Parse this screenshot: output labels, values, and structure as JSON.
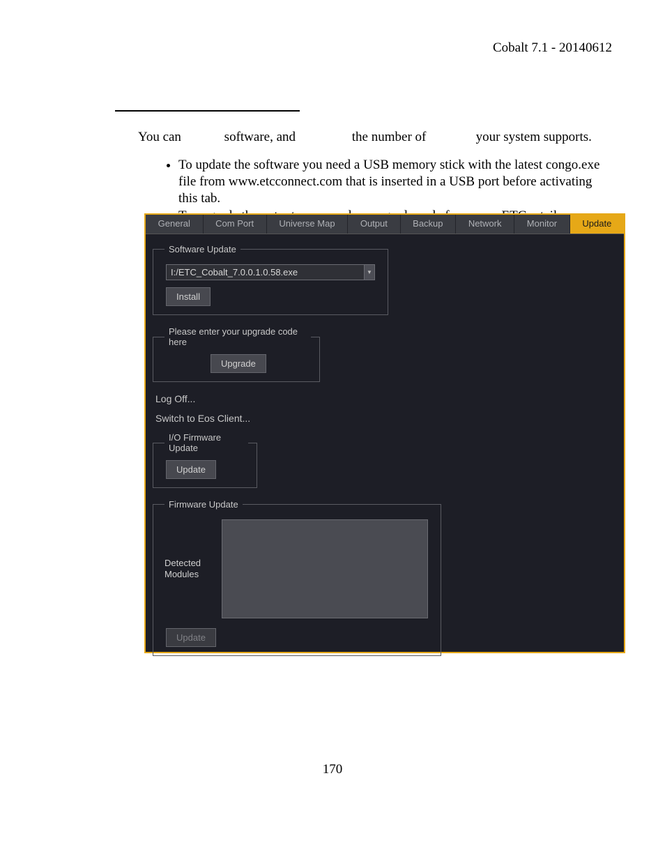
{
  "header": {
    "title": "Cobalt 7.1 - 20140612"
  },
  "intro": {
    "text": "You can             software, and                 the number of               your system supports."
  },
  "bullets": [
    "To update the software you need a USB memory stick with the latest congo.exe file from www.etcconnect.com that is inserted in a USB port before activating this tab.",
    "To upgrade the outputs you need an upgrade code from your ETC retailer."
  ],
  "page_number": "170",
  "app": {
    "tabs": [
      {
        "label": "General",
        "active": false
      },
      {
        "label": "Com Port",
        "active": false
      },
      {
        "label": "Universe Map",
        "active": false
      },
      {
        "label": "Output",
        "active": false
      },
      {
        "label": "Backup",
        "active": false
      },
      {
        "label": "Network",
        "active": false
      },
      {
        "label": "Monitor",
        "active": false
      },
      {
        "label": "Update",
        "active": true
      }
    ],
    "software_update": {
      "legend": "Software Update",
      "path": "I:/ETC_Cobalt_7.0.0.1.0.58.exe",
      "install_label": "Install"
    },
    "upgrade_code": {
      "legend": "Please enter your upgrade code here",
      "upgrade_label": "Upgrade"
    },
    "log_off_label": "Log Off...",
    "switch_eos_label": "Switch to Eos Client...",
    "io_firmware": {
      "legend": "I/O Firmware Update",
      "update_label": "Update"
    },
    "firmware": {
      "legend": "Firmware Update",
      "detected_label": "Detected Modules",
      "update_label": "Update"
    }
  }
}
